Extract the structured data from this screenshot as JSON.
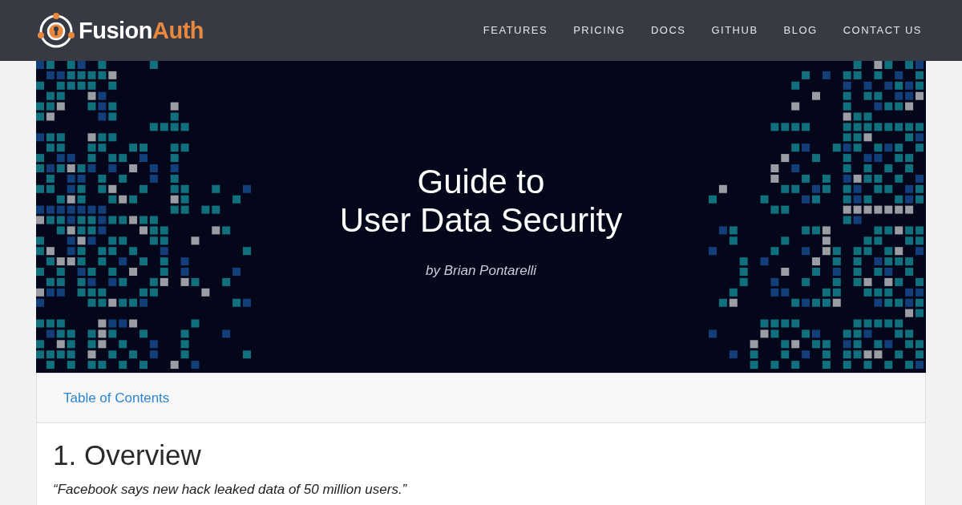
{
  "header": {
    "logo": {
      "part_1": "Fusion",
      "part_2": "Auth"
    },
    "nav": [
      {
        "label": "FEATURES"
      },
      {
        "label": "PRICING"
      },
      {
        "label": "DOCS"
      },
      {
        "label": "GITHUB"
      },
      {
        "label": "BLOG"
      },
      {
        "label": "CONTACT US"
      }
    ]
  },
  "hero": {
    "title_lines": [
      "Guide to",
      "User Data Security"
    ],
    "byline": "by Brian Pontarelli"
  },
  "toc": {
    "link": "Table of Contents"
  },
  "article": {
    "heading": "1. Overview",
    "quote": "“Facebook says new hack leaked data of 50 million users.”"
  }
}
